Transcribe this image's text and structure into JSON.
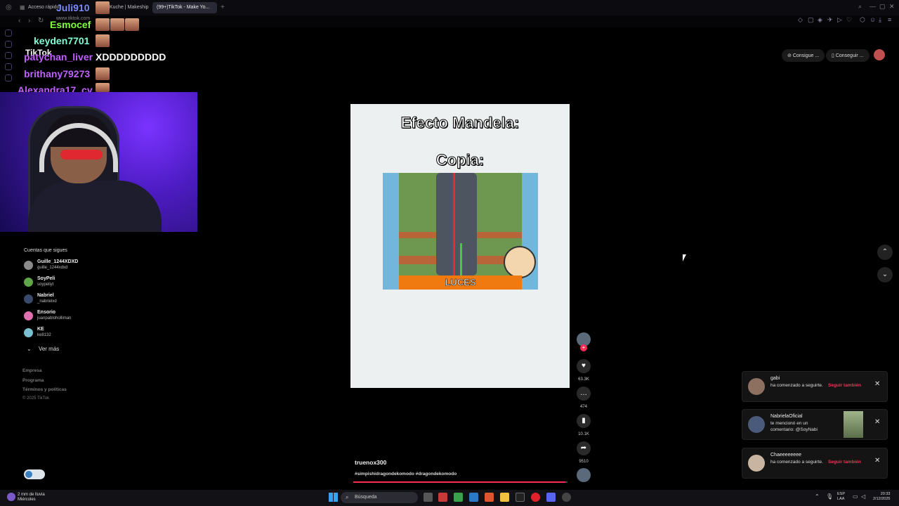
{
  "browser": {
    "tabs": [
      "Acceso rápido",
      "Kuche | Makeship",
      "(99+)TikTok - Make Yo..."
    ],
    "url": "www.tiktok.com"
  },
  "chat": {
    "users": [
      {
        "name": "Juli910",
        "color": "#7b8cff"
      },
      {
        "name": "Esmocef",
        "color": "#7fff3a"
      },
      {
        "name": "keyden7701",
        "color": "#7fffd8"
      },
      {
        "name": "patychan_liver",
        "color": "#c060ff"
      },
      {
        "name": "brithany79273",
        "color": "#c060ff"
      },
      {
        "name": "Alexandra17_cv",
        "color": "#c060ff"
      }
    ],
    "message": "XDDDDDDDDD",
    "overlay_logo": "TikTok"
  },
  "sidebar": {
    "following_title": "Cuentas que sigues",
    "accounts": [
      {
        "name": "Guille_1244XDXD",
        "id": "guille_1244xdxd"
      },
      {
        "name": "SoyPeli",
        "id": "soypeliyt"
      },
      {
        "name": "Nabriel",
        "id": "_nabrielxd"
      },
      {
        "name": "Ensorio",
        "id": "juanpabloholliman"
      },
      {
        "name": "KE",
        "id": "ke8132"
      }
    ],
    "see_more": "Ver más",
    "footer": [
      "Empresa",
      "Programa",
      "Términos y políticas",
      "© 2025 TikTok"
    ]
  },
  "video": {
    "title": "Efecto Mandela:",
    "subtitle": "Copia:",
    "caption_word": "LUCES",
    "author": "truenox300",
    "hashtags": "#simpishidragondekomodo #dragondekomodo",
    "progress": 0.99
  },
  "rail": {
    "likes": "63.3K",
    "comments": "474",
    "saves": "10.1K",
    "shares": "9510"
  },
  "top_buttons": [
    "Consigue ...",
    "Conseguir ..."
  ],
  "notifications": [
    {
      "name": "gabi",
      "text": "ha comenzado a seguirte.",
      "action": "Seguir también"
    },
    {
      "name": "NabrielaOficial",
      "text": "te mencionó en un comentario: @SoyNabi",
      "action": ""
    },
    {
      "name": "Chaeeeeeeee",
      "text": "ha comenzado a seguirte.",
      "action": "Seguir también"
    }
  ],
  "taskbar": {
    "weather_line1": "2 mm de lluvia",
    "weather_line2": "Miércoles",
    "search": "Búsqueda",
    "lang1": "ESP",
    "lang2": "LAA",
    "time": "20:33",
    "date": "2/12/2025"
  }
}
